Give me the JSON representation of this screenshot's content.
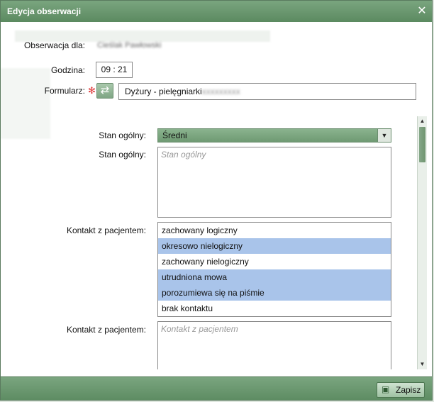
{
  "dialog": {
    "title": "Edycja obserwacji"
  },
  "fields": {
    "observation_for_label": "Obserwacja dla:",
    "observation_for_value": "Cieślak Pawłowski",
    "time_label": "Godzina:",
    "time_value": "09 : 21",
    "form_label": "Formularz:",
    "form_value": "Dyżury - pielęgniarki",
    "form_value_blurred": "xxxxxxxxx"
  },
  "sections": {
    "general_state_label": "Stan ogólny:",
    "general_state_selected": "Średni",
    "general_state_text_label": "Stan ogólny:",
    "general_state_placeholder": "Stan ogólny",
    "contact_label": "Kontakt z pacjentem:",
    "contact_options": [
      {
        "label": "zachowany logiczny",
        "selected": false
      },
      {
        "label": "okresowo nielogiczny",
        "selected": true
      },
      {
        "label": "zachowany nielogiczny",
        "selected": false
      },
      {
        "label": "utrudniona mowa",
        "selected": true
      },
      {
        "label": "porozumiewa się na piśmie",
        "selected": true
      },
      {
        "label": "brak kontaktu",
        "selected": false
      }
    ],
    "contact_text_label": "Kontakt z pacjentem:",
    "contact_placeholder": "Kontakt z pacjentem"
  },
  "footer": {
    "save_label": "Zapisz"
  },
  "colors": {
    "accent": "#6b9a70",
    "selection": "#a9c4ea"
  }
}
